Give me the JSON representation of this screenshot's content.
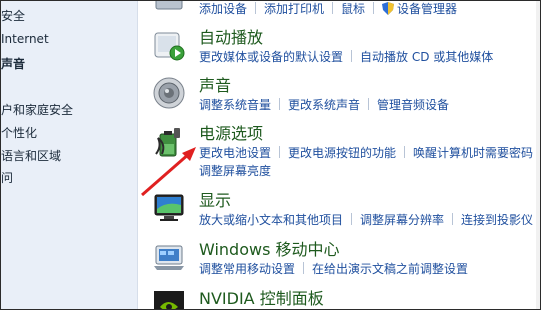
{
  "left_pane": {
    "items": [
      {
        "label": "安全",
        "bold": false
      },
      {
        "label": " Internet",
        "bold": false
      },
      {
        "label": "声音",
        "bold": true
      },
      {
        "label": "户和家庭安全",
        "bold": false
      },
      {
        "label": "个性化",
        "bold": false
      },
      {
        "label": "语言和区域",
        "bold": false
      },
      {
        "label": "问",
        "bold": false
      }
    ]
  },
  "categories": [
    {
      "id": "hardware-partial",
      "title": "",
      "links": [
        "添加设备",
        "添加打印机",
        "鼠标",
        "设备管理器"
      ]
    },
    {
      "id": "autoplay",
      "title": "自动播放",
      "links": [
        "更改媒体或设备的默认设置",
        "自动播放 CD 或其他媒体"
      ]
    },
    {
      "id": "sound",
      "title": "声音",
      "links": [
        "调整系统音量",
        "更改系统声音",
        "管理音频设备"
      ]
    },
    {
      "id": "power",
      "title": "电源选项",
      "links": [
        "更改电池设置",
        "更改电源按钮的功能",
        "唤醒计算机时需要密码",
        "调整屏幕亮度"
      ]
    },
    {
      "id": "display",
      "title": "显示",
      "links": [
        "放大或缩小文本和其他项目",
        "调整屏幕分辨率",
        "连接到投影仪"
      ]
    },
    {
      "id": "mobility",
      "title": "Windows 移动中心",
      "links": [
        "调整常用移动设置",
        "在给出演示文稿之前调整设置"
      ]
    },
    {
      "id": "nvidia",
      "title": "NVIDIA 控制面板",
      "links": []
    }
  ],
  "colors": {
    "link": "#1f4f9e",
    "title": "#1e5a1e",
    "left_pane_bg": "#e9eff8",
    "annotation_arrow": "#e02020"
  }
}
